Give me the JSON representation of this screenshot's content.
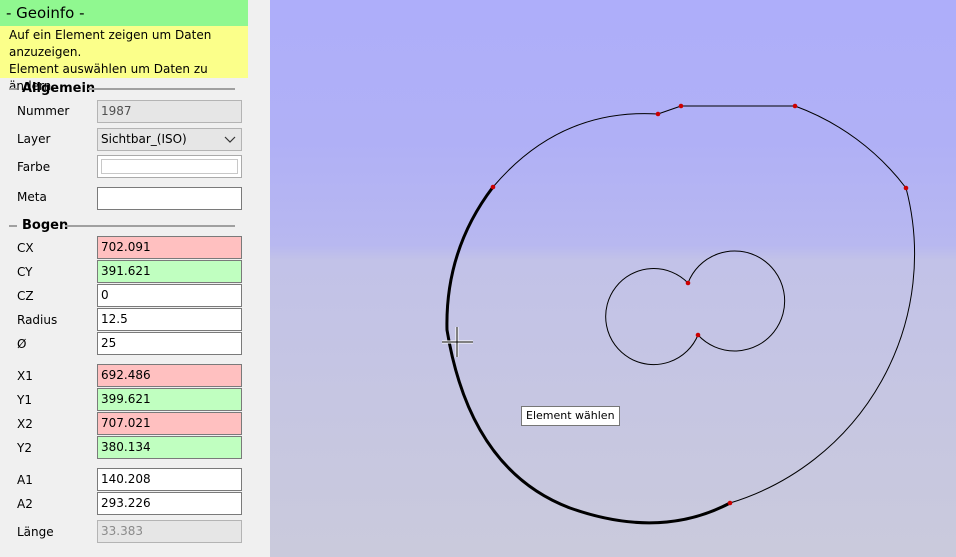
{
  "panel": {
    "title": "- Geoinfo -",
    "hint_lines": [
      "Auf ein Element zeigen um Daten",
      "anzuzeigen.",
      "Element auswählen um Daten zu ändern."
    ]
  },
  "general": {
    "section_title": "Allgemein",
    "number_label": "Nummer",
    "number_value": "1987",
    "layer_label": "Layer",
    "layer_value": "Sichtbar_(ISO)",
    "color_label": "Farbe",
    "color_value": "",
    "meta_label": "Meta",
    "meta_value": ""
  },
  "arc": {
    "section_title": "Bogen",
    "cx_label": "CX",
    "cx_value": "702.091",
    "cy_label": "CY",
    "cy_value": "391.621",
    "cz_label": "CZ",
    "cz_value": "0",
    "radius_label": "Radius",
    "radius_value": "12.5",
    "diameter_label": "Ø",
    "diameter_value": "25",
    "x1_label": "X1",
    "x1_value": "692.486",
    "y1_label": "Y1",
    "y1_value": "399.621",
    "x2_label": "X2",
    "x2_value": "707.021",
    "y2_label": "Y2",
    "y2_value": "380.134",
    "a1_label": "A1",
    "a1_value": "140.208",
    "a2_label": "A2",
    "a2_value": "293.226",
    "length_label": "Länge",
    "length_value": "33.383"
  },
  "canvas": {
    "tooltip": "Element wählen"
  },
  "colors": {
    "title_bg": "#90f890",
    "hint_bg": "#fbff8a",
    "field_red": "#ffc0c0",
    "field_green": "#c0ffc0",
    "node_color": "#cc0000"
  }
}
